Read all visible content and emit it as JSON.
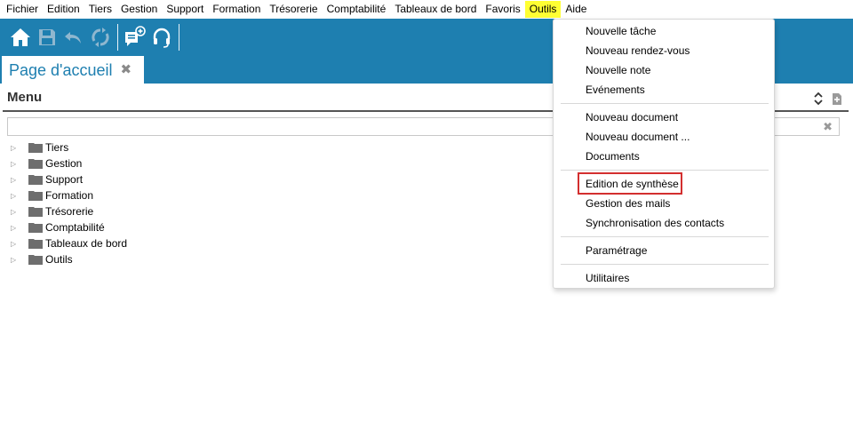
{
  "menubar": {
    "items": [
      "Fichier",
      "Edition",
      "Tiers",
      "Gestion",
      "Support",
      "Formation",
      "Trésorerie",
      "Comptabilité",
      "Tableaux de bord",
      "Favoris",
      "Outils",
      "Aide"
    ],
    "active": "Outils"
  },
  "toolbar": {
    "icons": [
      "home-icon",
      "save-icon",
      "undo-icon",
      "refresh-icon",
      "new-message-icon",
      "headset-icon"
    ]
  },
  "tab": {
    "label": "Page d'accueil",
    "close": "✖"
  },
  "panel": {
    "title": "Menu"
  },
  "search": {
    "value": "",
    "clear": "✖"
  },
  "tree": {
    "items": [
      "Tiers",
      "Gestion",
      "Support",
      "Formation",
      "Trésorerie",
      "Comptabilité",
      "Tableaux de bord",
      "Outils"
    ]
  },
  "dropdown": {
    "groups": [
      [
        "Nouvelle tâche",
        "Nouveau rendez-vous",
        "Nouvelle note",
        "Evénements"
      ],
      [
        "Nouveau document",
        "Nouveau document ...",
        "Documents"
      ],
      [
        "Edition de synthèse",
        "Gestion des mails",
        "Synchronisation des contacts"
      ],
      [
        "Paramétrage"
      ],
      [
        "Utilitaires"
      ]
    ],
    "highlighted": "Edition de synthèse"
  },
  "colors": {
    "toolbar": "#1e7fb0",
    "active_menu": "#ffff33",
    "highlight_border": "#d32f2f"
  }
}
